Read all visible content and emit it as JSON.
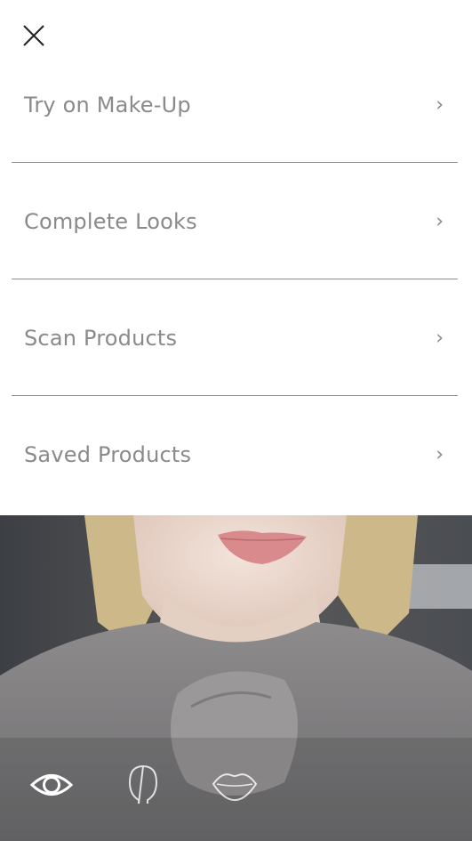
{
  "menu": {
    "items": [
      {
        "label": "Try on Make-Up",
        "chevron": "›"
      },
      {
        "label": "Complete Looks",
        "chevron": "›"
      },
      {
        "label": "Scan Products",
        "chevron": "›"
      },
      {
        "label": "Saved Products",
        "chevron": "›"
      }
    ]
  },
  "icons": {
    "close": "close-icon",
    "eye": "eye-icon",
    "face": "face-icon",
    "lips": "lips-icon"
  },
  "colors": {
    "text": "#8a8a8a",
    "divider": "#8c8c8c",
    "lip": "#d98a8c"
  }
}
